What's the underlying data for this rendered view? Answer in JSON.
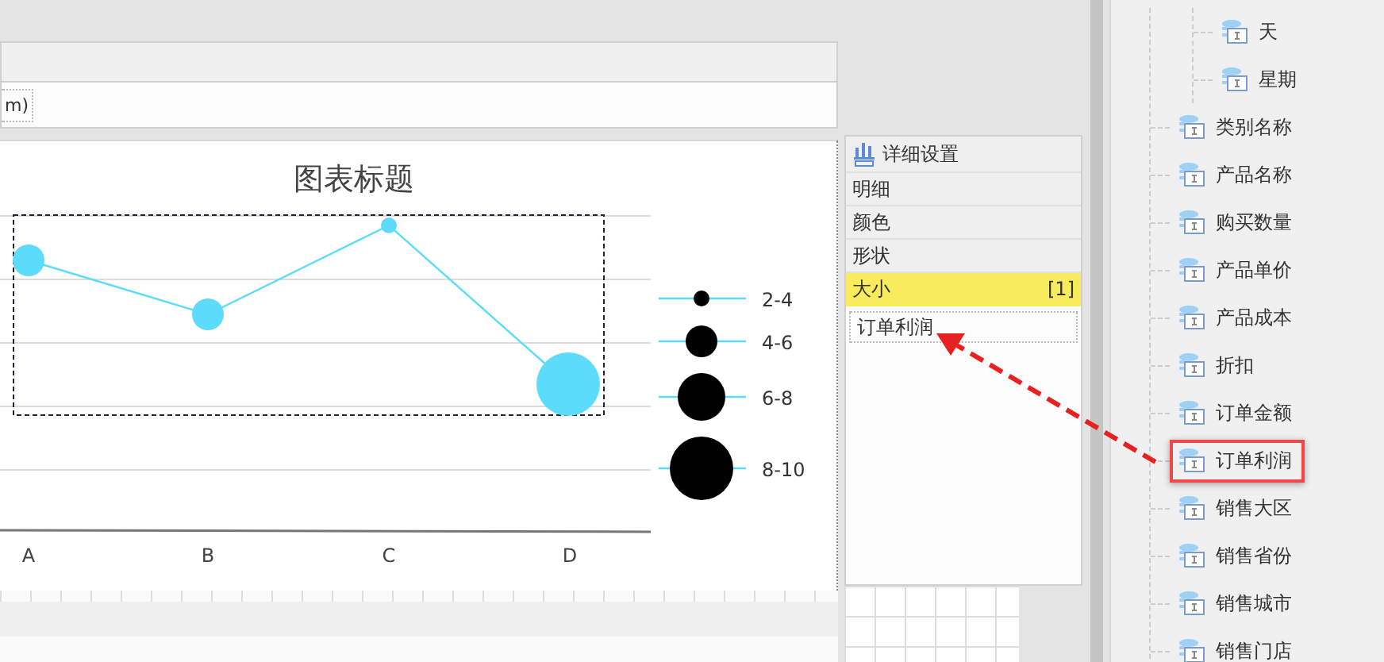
{
  "toolbar": {
    "text": "m)"
  },
  "chart": {
    "title": "图表标题",
    "categories": [
      "A",
      "B",
      "C",
      "D"
    ],
    "legend": [
      {
        "label": "2-4"
      },
      {
        "label": "4-6"
      },
      {
        "label": "6-8"
      },
      {
        "label": "8-10"
      }
    ]
  },
  "detail_panel": {
    "title": "详细设置",
    "rows": [
      {
        "label": "明细",
        "selected": false
      },
      {
        "label": "颜色",
        "selected": false
      },
      {
        "label": "形状",
        "selected": false
      },
      {
        "label": "大小",
        "count": "[1]",
        "selected": true
      }
    ],
    "size_field": "订单利润"
  },
  "tree": {
    "children": [
      {
        "children": [
          {
            "label": "天",
            "highlighted": false
          },
          {
            "label": "星期",
            "highlighted": false
          }
        ]
      },
      {
        "label": "类别名称",
        "highlighted": false
      },
      {
        "label": "产品名称",
        "highlighted": false
      },
      {
        "label": "购买数量",
        "highlighted": false
      },
      {
        "label": "产品单价",
        "highlighted": false
      },
      {
        "label": "产品成本",
        "highlighted": false
      },
      {
        "label": "折扣",
        "highlighted": false
      },
      {
        "label": "订单金额",
        "highlighted": false
      },
      {
        "label": "订单利润",
        "highlighted": true
      },
      {
        "label": "销售大区",
        "highlighted": false
      },
      {
        "label": "销售省份",
        "highlighted": false
      },
      {
        "label": "销售城市",
        "highlighted": false
      },
      {
        "label": "销售门店",
        "highlighted": false
      }
    ]
  }
}
